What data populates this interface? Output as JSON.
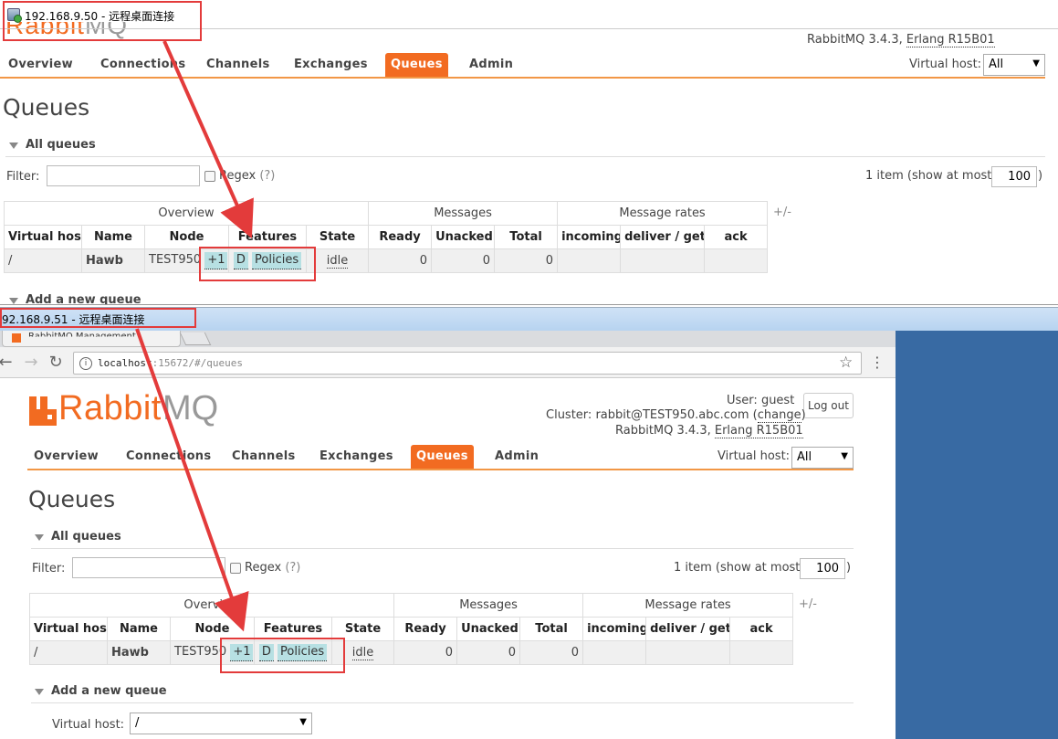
{
  "windows": {
    "top_title": "192.168.9.50 - 远程桌面连接",
    "bottom_title": "92.168.9.51 - 远程桌面连接"
  },
  "browser": {
    "tab_label": "RabbitMQ Management",
    "url_host": "localhost",
    "url_path": ":15672/#/queues"
  },
  "rabbitmq": {
    "logo_rabbit": "Rabbit",
    "logo_mq": "MQ",
    "logo_peek": "Rabbit",
    "logo_peek_mq": "MQ",
    "user_label": "User:",
    "user": "guest",
    "logout": "Log out",
    "cluster_label": "Cluster:",
    "cluster": "rabbit@TEST950.abc.com",
    "change": "change",
    "version_prefix": "RabbitMQ 3.4.3,",
    "erlang": "Erlang R15B01",
    "nav": [
      "Overview",
      "Connections",
      "Channels",
      "Exchanges",
      "Queues",
      "Admin"
    ],
    "active_nav": "Queues",
    "virtual_host_label": "Virtual host:",
    "virtual_host_value": "All",
    "page_title": "Queues",
    "all_queues": "All queues",
    "filter_label": "Filter:",
    "regex_label": "Regex",
    "regex_help": "(?)",
    "items_text": "1 item (show at most",
    "show_at_most": "100",
    "close_paren": ")",
    "plus_minus": "+/-",
    "add_queue": "Add a new queue",
    "add_vhost_label": "Virtual host:",
    "add_vhost_value": "/",
    "table": {
      "groups": [
        "Overview",
        "Messages",
        "Message rates"
      ],
      "columns": [
        "Virtual host",
        "Name",
        "Node",
        "Features",
        "State",
        "Ready",
        "Unacked",
        "Total",
        "incoming",
        "deliver / get",
        "ack"
      ],
      "row": {
        "vhost": "/",
        "name": "Hawb",
        "node": "TEST950",
        "node_extra": "+1",
        "feature_d": "D",
        "feature_policies": "Policies",
        "state": "idle",
        "ready": "0",
        "unacked": "0",
        "total": "0",
        "incoming": "",
        "deliver_get": "",
        "ack": ""
      }
    }
  },
  "colors": {
    "accent": "#f26b21",
    "annotation": "#e33b3b",
    "feature_tag": "#b7e0e3",
    "desktop_bg": "#386aa3"
  }
}
